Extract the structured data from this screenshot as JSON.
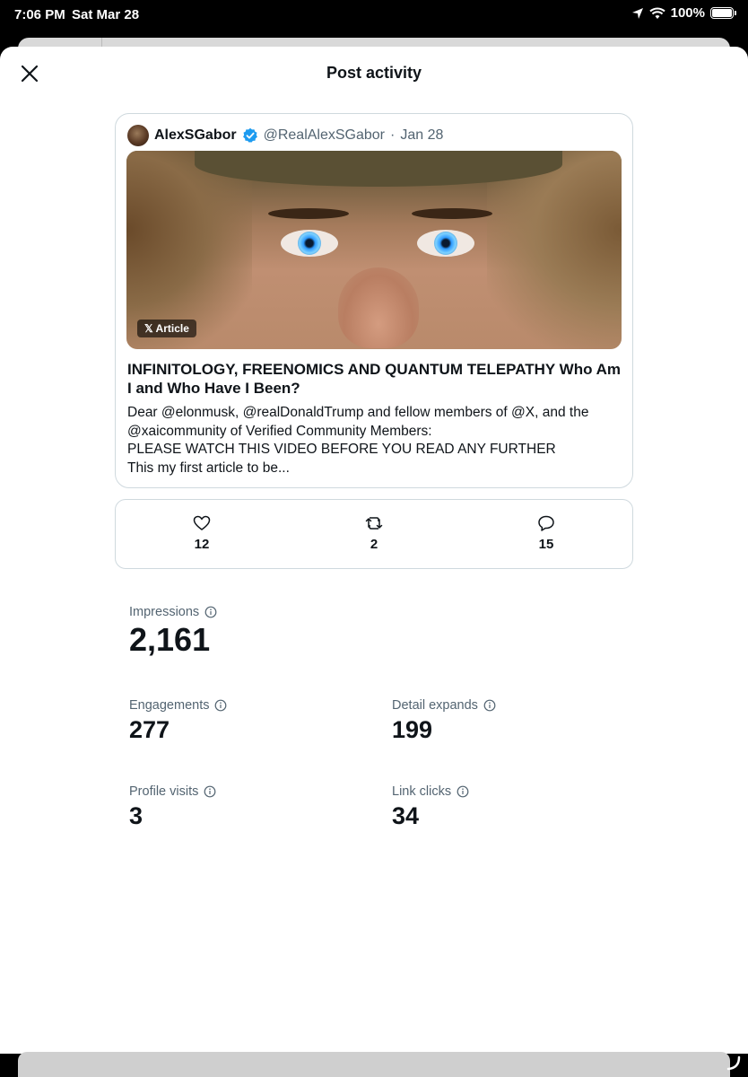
{
  "status_bar": {
    "time": "7:06 PM",
    "date": "Sat Mar 28",
    "battery": "100%"
  },
  "modal": {
    "title": "Post activity"
  },
  "post": {
    "author_name": "AlexSGabor",
    "handle": "@RealAlexSGabor",
    "separator": "·",
    "date": "Jan 28",
    "badge": "𝕏 Article",
    "title": "INFINITOLOGY, FREENOMICS AND QUANTUM TELEPATHY Who Am I and Who Have I Been?",
    "body_lines": [
      "Dear @elonmusk, @realDonaldTrump and fellow members of @X, and the",
      "@xaicommunity of Verified Community Members:",
      "PLEASE WATCH THIS VIDEO BEFORE YOU READ ANY FURTHER",
      "This my first article to be..."
    ]
  },
  "engagement": {
    "likes": "12",
    "reposts": "2",
    "replies": "15"
  },
  "metrics": {
    "impressions": {
      "label": "Impressions",
      "value": "2,161"
    },
    "engagements": {
      "label": "Engagements",
      "value": "277"
    },
    "detail_expands": {
      "label": "Detail expands",
      "value": "199"
    },
    "profile_visits": {
      "label": "Profile visits",
      "value": "3"
    },
    "link_clicks": {
      "label": "Link clicks",
      "value": "34"
    }
  },
  "colors": {
    "accent": "#1d9bf0",
    "text": "#0f1419",
    "muted": "#536471",
    "border": "#cfd9de"
  }
}
